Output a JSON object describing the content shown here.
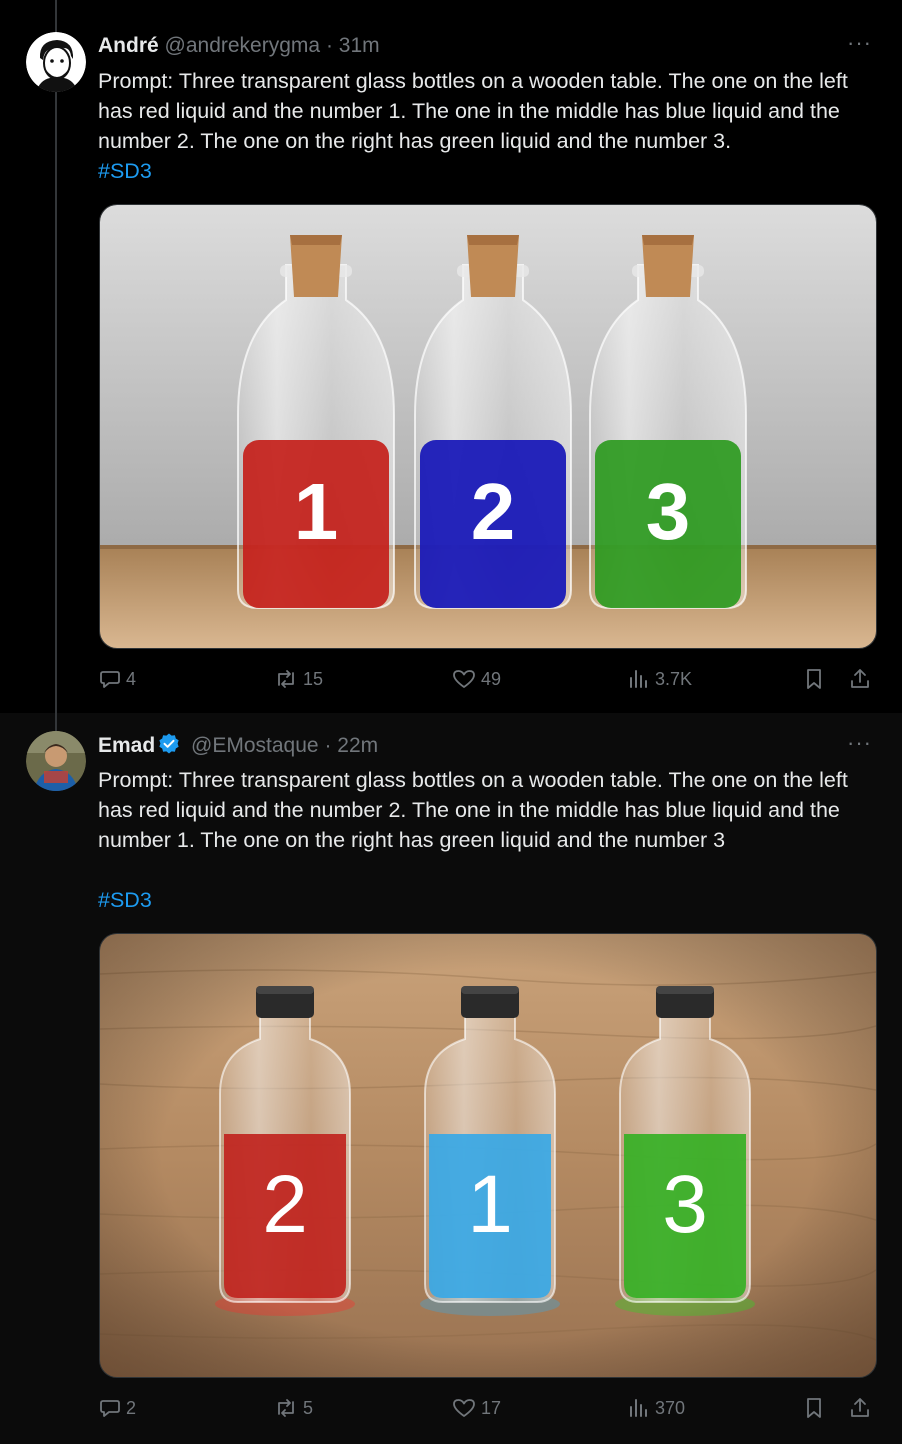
{
  "tweets": [
    {
      "name": "André",
      "handle": "@andrekerygma",
      "dot": "·",
      "time": "31m",
      "more": "···",
      "prompt": "Prompt: Three transparent glass bottles on a wooden table. The one on the left has red liquid and the number 1. The one in the middle has blue liquid and the number 2. The one on the right has green liquid and the number 3.",
      "hashtag": "#SD3",
      "bottles": [
        {
          "number": "1",
          "color": "#c4201a"
        },
        {
          "number": "2",
          "color": "#1a1ab8"
        },
        {
          "number": "3",
          "color": "#2c9a20"
        }
      ],
      "stats": {
        "replies": "4",
        "reposts": "15",
        "likes": "49",
        "views": "3.7K"
      }
    },
    {
      "name": "Emad",
      "handle": "@EMostaque",
      "dot": "·",
      "time": "22m",
      "more": "···",
      "prompt": "Prompt: Three transparent glass bottles on a wooden table. The one on the left has red liquid and the number 2. The one in the middle has blue liquid and the number 1. The one on the right has green liquid and the number 3",
      "hashtag": "#SD3",
      "bottles": [
        {
          "number": "2",
          "color": "#c0241e"
        },
        {
          "number": "1",
          "color": "#38a8e6"
        },
        {
          "number": "3",
          "color": "#36b025"
        }
      ],
      "stats": {
        "replies": "2",
        "reposts": "5",
        "likes": "17",
        "views": "370"
      }
    }
  ],
  "colors": {
    "accent": "#1d9bf0",
    "muted": "#71767b",
    "verified": "#1d9bf0"
  },
  "icons": [
    "reply-icon",
    "repost-icon",
    "like-icon",
    "views-icon",
    "bookmark-icon",
    "share-icon",
    "verified-badge-icon",
    "more-icon"
  ]
}
